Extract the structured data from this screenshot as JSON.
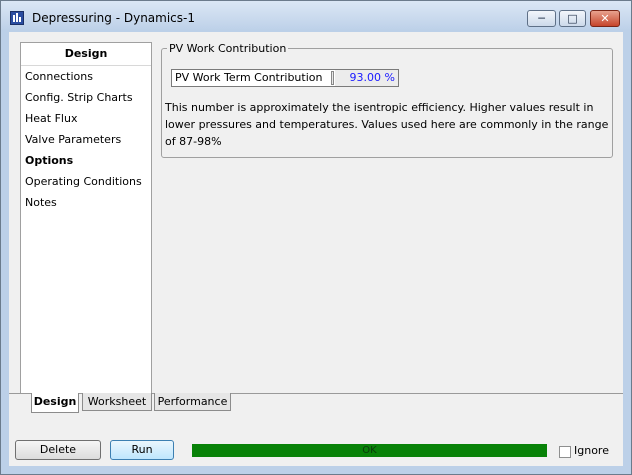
{
  "window": {
    "title": "Depressuring - Dynamics-1",
    "minimize_glyph": "─",
    "maximize_glyph": "□",
    "close_glyph": "✕"
  },
  "sidebar": {
    "header": "Design",
    "items": [
      {
        "label": "Connections",
        "active": false
      },
      {
        "label": "Config. Strip Charts",
        "active": false
      },
      {
        "label": "Heat Flux",
        "active": false
      },
      {
        "label": "Valve Parameters",
        "active": false
      },
      {
        "label": "Options",
        "active": true
      },
      {
        "label": "Operating Conditions",
        "active": false
      },
      {
        "label": "Notes",
        "active": false
      }
    ]
  },
  "group": {
    "title": "PV Work Contribution",
    "field_label": "PV Work Term Contribution",
    "field_value": "93.00 %",
    "description": "This number is approximately the isentropic efficiency.  Higher values result in lower pressures and temperatures.  Values used here are commonly in the range of 87-98%"
  },
  "tabs": [
    {
      "label": "Design",
      "active": true
    },
    {
      "label": "Worksheet",
      "active": false
    },
    {
      "label": "Performance",
      "active": false
    }
  ],
  "footer": {
    "delete_label": "Delete",
    "run_label": "Run",
    "status": "OK",
    "ignore_label": "Ignore",
    "ignore_checked": false
  },
  "colors": {
    "status_ok": "#088208",
    "value_text": "#1a1aff",
    "close_button": "#c6452b"
  }
}
